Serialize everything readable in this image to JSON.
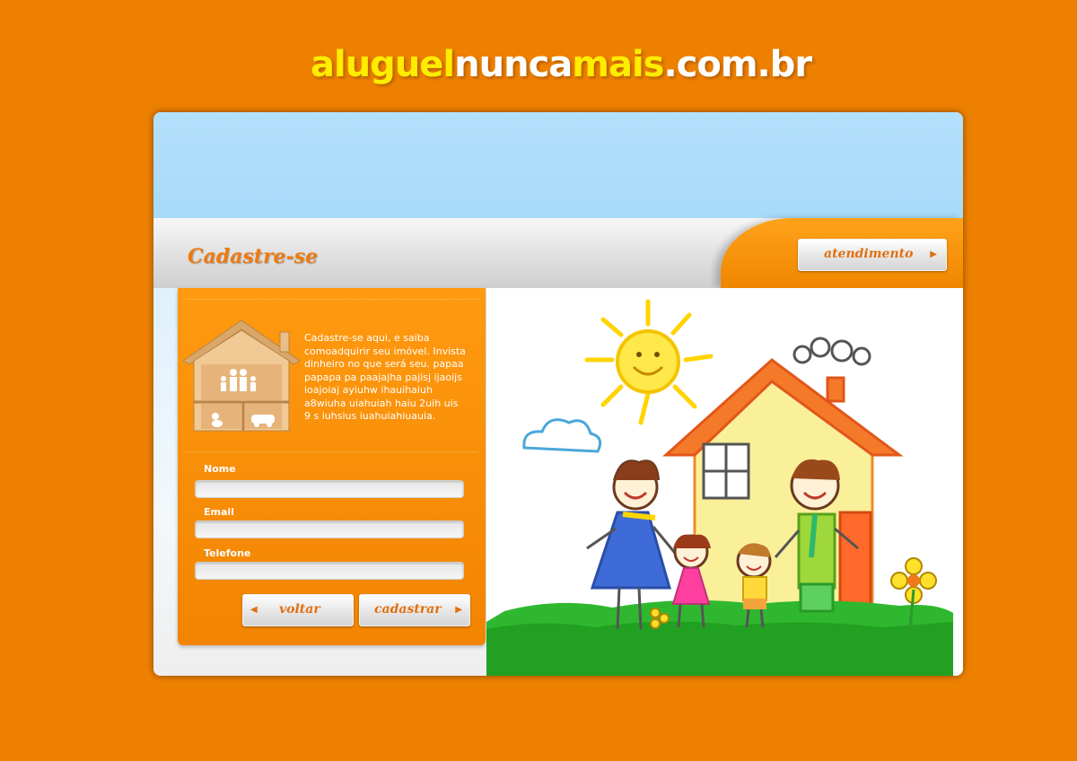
{
  "logo": {
    "part1": "aluguel",
    "part2": "nunca",
    "part3": "mais",
    "part4": ".com.br"
  },
  "header": {
    "title": "Cadastre-se",
    "support_button": "atendimento"
  },
  "intro": {
    "text": "Cadastre-se aqui, e saiba\ncomoadquirir seu imóvel. Invista\ndinheiro no que será seu. papaa\npapapa pa paajajha pajisj ijaoijs\nioajoiaj ayiuhw  ihauihaiuh\na8wiuha uiahuiah haiu  2uih uis\n9 s iuhsius iuahuiahiuauia."
  },
  "form": {
    "name_label": "Nome",
    "name_value": "",
    "email_label": "Email",
    "email_value": "",
    "phone_label": "Telefone",
    "phone_value": "",
    "back_button": "voltar",
    "submit_button": "cadastrar"
  },
  "colors": {
    "background": "#ee8000",
    "logo_yellow": "#ffec00",
    "accent_text": "#ee7a10",
    "sky": "#b3e0fb"
  },
  "icons": {
    "family_house": "family-house-shelf-icon",
    "forward": "triangle-right-icon",
    "back": "triangle-left-icon"
  }
}
